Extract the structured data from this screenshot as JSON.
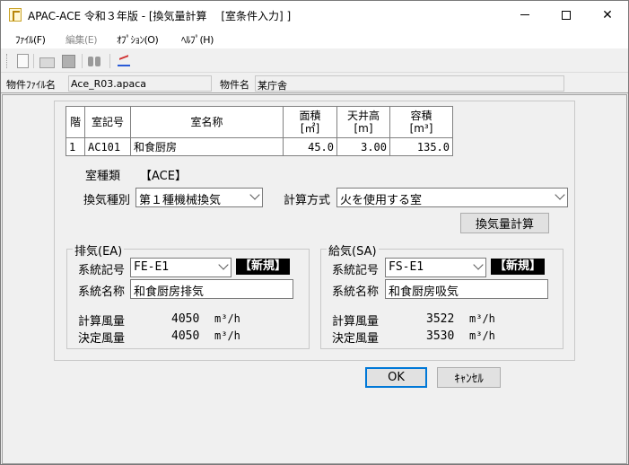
{
  "window": {
    "title": "APAC-ACE 令和３年版 - [換気量計算 　[室条件入力] ]",
    "min_label": "",
    "close_label": "✕"
  },
  "menu": {
    "file": "ﾌｧｲﾙ(F)",
    "edit": "編集(E)",
    "option": "ｵﾌﾟｼｮﾝ(O)",
    "help": "ﾍﾙﾌﾟ(H)"
  },
  "toolbar_icons": [
    "new-icon",
    "open-icon",
    "save-icon",
    "find-icon",
    "chart-icon"
  ],
  "info": {
    "file_label": "物件ﾌｧｲﾙ名",
    "file_value": "Ace_R03.apaca",
    "name_label": "物件名",
    "name_value": "某庁舎"
  },
  "table": {
    "headers": {
      "floor": "階",
      "room_code": "室記号",
      "room_name": "室名称",
      "area": "面積",
      "area_unit": "[㎡]",
      "height": "天井高",
      "height_unit": "[m]",
      "volume": "容積",
      "volume_unit": "[m³]"
    },
    "rows": [
      {
        "floor": "1",
        "room_code": "AC101",
        "room_name": "和食厨房",
        "area": "45.0",
        "height": "3.00",
        "volume": "135.0"
      }
    ]
  },
  "room_type": {
    "label": "室種類",
    "value": "【ACE】"
  },
  "vent_type": {
    "label": "換気種別",
    "value": "第１種機械換気"
  },
  "calc_method": {
    "label": "計算方式",
    "value": "火を使用する室"
  },
  "calc_button": "換気量計算",
  "exhaust": {
    "legend": "排気(EA)",
    "system_code_label": "系統記号",
    "system_code": "FE-E1",
    "badge": "【新規】",
    "system_name_label": "系統名称",
    "system_name": "和食厨房排気",
    "calc_flow_label": "計算風量",
    "calc_flow": "4050",
    "decided_flow_label": "決定風量",
    "decided_flow": "4050",
    "unit": "m³/h"
  },
  "supply": {
    "legend": "給気(SA)",
    "system_code_label": "系統記号",
    "system_code": "FS-E1",
    "badge": "【新規】",
    "system_name_label": "系統名称",
    "system_name": "和食厨房吸気",
    "calc_flow_label": "計算風量",
    "calc_flow": "3522",
    "decided_flow_label": "決定風量",
    "decided_flow": "3530",
    "unit": "m³/h"
  },
  "buttons": {
    "ok": "OK",
    "cancel": "ｷｬﾝｾﾙ"
  }
}
